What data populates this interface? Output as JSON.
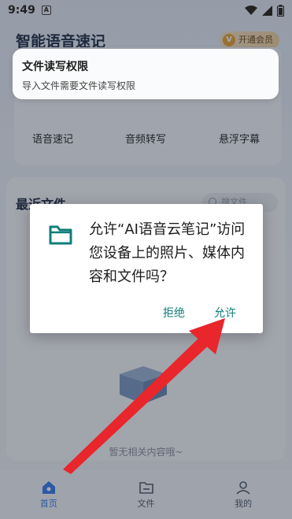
{
  "status_bar": {
    "time": "9:49",
    "notification_icon": "A"
  },
  "app": {
    "title": "智能语音速记",
    "vip_label": "开通会员",
    "tools": [
      {
        "label": "语音速记",
        "icon": "microphone-icon"
      },
      {
        "label": "音频转写",
        "icon": "audio-transcribe-icon"
      },
      {
        "label": "悬浮字幕",
        "icon": "floating-subtitle-icon"
      }
    ],
    "recent_title": "最近文件",
    "search_placeholder": "搜文件",
    "empty_text": "暂无相关内容哦~"
  },
  "permission_toast": {
    "title": "文件读写权限",
    "description": "导入文件需要文件读写权限"
  },
  "dialog": {
    "message": "允许“AI语音云笔记”访问您设备上的照片、媒体内容和文件吗？",
    "deny_label": "拒绝",
    "allow_label": "允许",
    "icon": "folder-icon",
    "accent_color": "#0f7e78"
  },
  "bottom_nav": {
    "items": [
      {
        "label": "首页",
        "icon": "home-icon",
        "active": true
      },
      {
        "label": "文件",
        "icon": "file-folder-icon",
        "active": false
      },
      {
        "label": "我的",
        "icon": "profile-icon",
        "active": false
      }
    ]
  },
  "annotation": {
    "arrow_color": "#e8262c"
  }
}
